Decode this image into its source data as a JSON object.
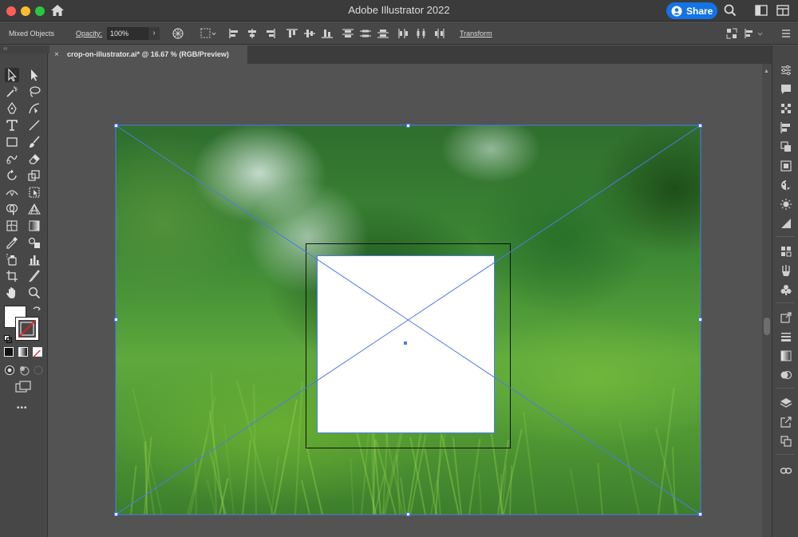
{
  "titlebar": {
    "title": "Adobe Illustrator 2022",
    "share_label": "Share"
  },
  "controlbar": {
    "object_type": "Mixed Objects",
    "opacity_label": "Opacity:",
    "opacity_value": "100%",
    "transform_label": "Transform"
  },
  "document": {
    "tab_label": "crop-on-illustrator.ai* @ 16.67 % (RGB/Preview)",
    "close_glyph": "×"
  },
  "toolbar": {
    "more_glyph": "•••",
    "collapse_glyph": "‹‹"
  },
  "colors": {
    "accent": "#1473e6",
    "selection": "#4a7be8",
    "panel": "#474747",
    "canvas": "#535353"
  }
}
